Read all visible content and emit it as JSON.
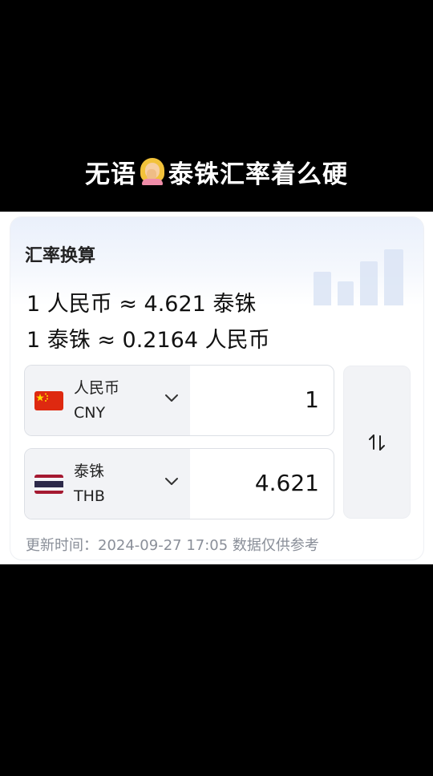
{
  "caption": {
    "left_text": "无语",
    "right_text": "泰铢汇率着么硬",
    "emoji_icon": "facepalm-woman-emoji"
  },
  "card": {
    "title": "汇率换算",
    "rate_line_1": "1 人民币 ≈ 4.621 泰铢",
    "rate_line_2": "1 泰铢 ≈ 0.2164 人民币",
    "from": {
      "name": "人民币",
      "code": "CNY",
      "amount": "1",
      "flag_icon": "china-flag-icon"
    },
    "to": {
      "name": "泰铢",
      "code": "THB",
      "amount": "4.621",
      "flag_icon": "thailand-flag-icon"
    },
    "swap_icon": "swap-arrows-icon",
    "updated_text": "更新时间：2024-09-27 17:05 数据仅供参考"
  },
  "colors": {
    "background": "#000000",
    "card_bg": "#ffffff",
    "field_left_bg": "#f2f3f6",
    "muted_text": "#8a8f99",
    "china_red": "#de2910",
    "thai_red": "#a51931",
    "thai_blue": "#2d2a4a"
  }
}
